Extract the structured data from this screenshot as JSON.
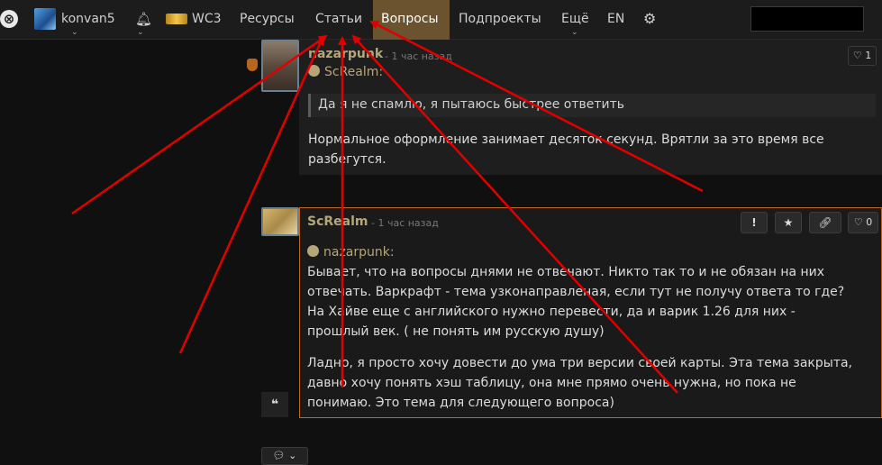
{
  "nav": {
    "user": "konvan5",
    "game": "WC3",
    "resources": "Ресурсы",
    "articles": "Статьи",
    "questions": "Вопросы",
    "subprojects": "Подпроекты",
    "more": "Ещё",
    "lang": "EN",
    "search_value": ""
  },
  "post1": {
    "author": "nazarpunk",
    "time": "- 1 час назад",
    "quote_author": "ScRealm:",
    "quote_text": "Да я не спамлю, я пытаюсь быстрее ответить",
    "lines": [
      "Нормальное оформление занимает десяток секунд. Врятли за это время все",
      "разбегутся."
    ],
    "likes": "1"
  },
  "post2": {
    "author": "ScRealm",
    "time": "- 1 час назад",
    "quote_author": "nazarpunk:",
    "para1": [
      "Бывает, что на вопросы днями не отвечают. Никто так то и не обязан на них",
      "отвечать. Варкрафт - тема узконаправленая, если тут не получу ответа то где?",
      "На Хайве еще с английского нужно перевести, да и варик 1.26 для них -",
      "прошлый век. ( не понять им русскую душу)"
    ],
    "para2": [
      "Ладно, я просто хочу довести до ума три версии своей карты. Эта тема закрыта,",
      "давно хочу понять хэш таблицу, она мне прямо очень нужна, но пока не",
      "понимаю. Это тема для следующего вопроса)"
    ],
    "likes": "0"
  },
  "icons": {
    "report": "exclamation-icon",
    "star": "star-icon",
    "link": "link-icon",
    "heart": "heart-icon",
    "bell": "bell-icon",
    "gear": "gear-icon"
  },
  "colors": {
    "active_tab": "#6b5330",
    "author": "#b5a67a",
    "highlight_border": "#c5651e",
    "arrow": "#e00000"
  }
}
